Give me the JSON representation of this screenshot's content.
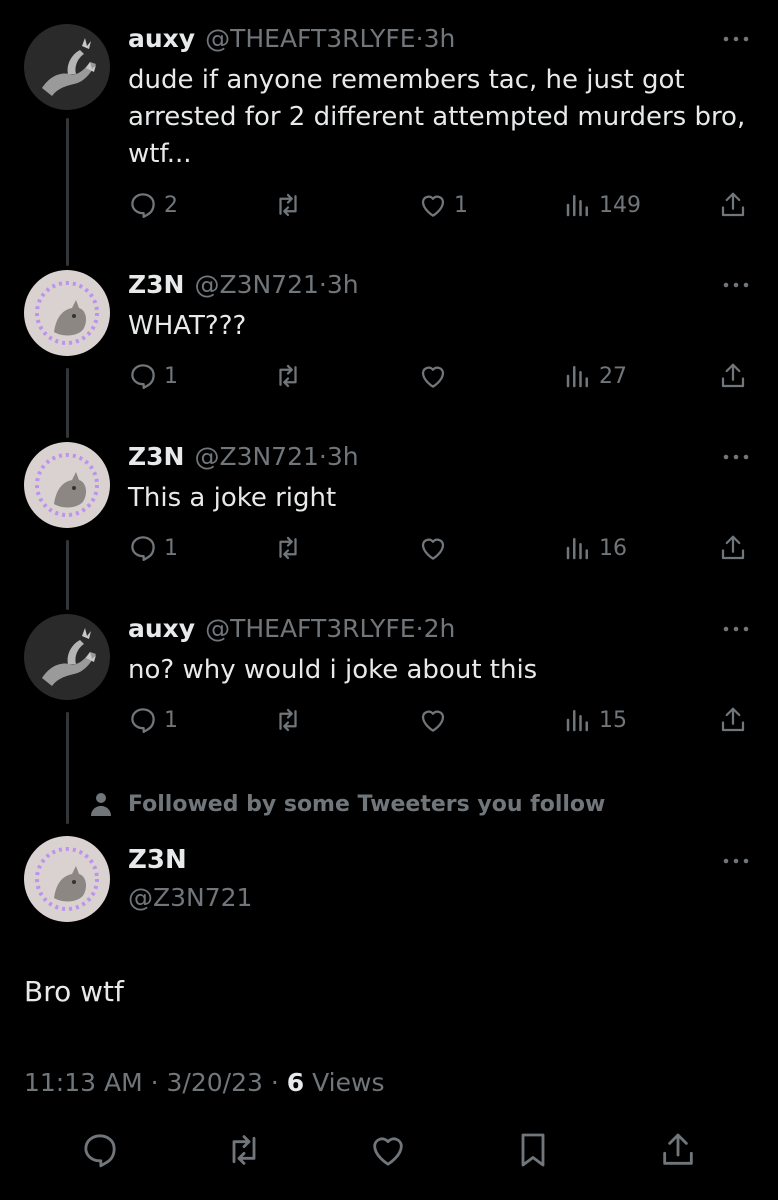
{
  "thread": [
    {
      "avatar": "hand-avatar",
      "name": "auxy",
      "handle": "@THEAFT3RLYFE",
      "time": "3h",
      "text": "dude if anyone remembers tac, he just got arrested for 2 different attempted murders bro, wtf...",
      "replies": "2",
      "retweets": "",
      "likes": "1",
      "views": "149"
    },
    {
      "avatar": "cat-avatar",
      "name": "Z3N",
      "handle": "@Z3N721",
      "time": "3h",
      "text": "WHAT???",
      "replies": "1",
      "retweets": "",
      "likes": "",
      "views": "27"
    },
    {
      "avatar": "cat-avatar",
      "name": "Z3N",
      "handle": "@Z3N721",
      "time": "3h",
      "text": "This a joke right",
      "replies": "1",
      "retweets": "",
      "likes": "",
      "views": "16"
    },
    {
      "avatar": "hand-avatar",
      "name": "auxy",
      "handle": "@THEAFT3RLYFE",
      "time": "2h",
      "text": "no? why would i joke about this",
      "replies": "1",
      "retweets": "",
      "likes": "",
      "views": "15"
    }
  ],
  "separator": "·",
  "followed_text": "Followed by some Tweeters you follow",
  "main_tweet": {
    "name": "Z3N",
    "handle": "@Z3N721",
    "text": "Bro wtf",
    "time": "11:13 AM",
    "date": "3/20/23",
    "views_count": "6",
    "views_label": "Views"
  },
  "icons": {
    "reply": "reply-icon",
    "retweet": "retweet-icon",
    "like": "heart-icon",
    "views": "views-icon",
    "share": "share-icon",
    "bookmark": "bookmark-icon",
    "more": "more-icon",
    "person": "person-icon"
  },
  "colors": {
    "background": "#000000",
    "text": "#e7e9ea",
    "secondary": "#71767b",
    "thread_line": "#333639",
    "avatar_glow": "#b98cf0"
  }
}
